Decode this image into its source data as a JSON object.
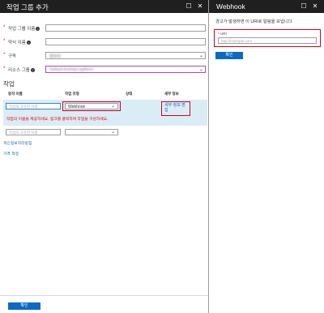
{
  "left_blade": {
    "title": "작업 그룹 추가",
    "form": {
      "group_name_label": "작업 그룹 이름",
      "short_name_label": "약식 이름",
      "subscription_label": "구독",
      "subscription_value": "종량제",
      "resource_group_label": "리소스 그룹",
      "resource_group_value": "Default-ActivityLogAlerts"
    },
    "actions_section": {
      "title": "작업",
      "columns": [
        "동작 이름",
        "작업 유형",
        "상태",
        "세부 정보"
      ],
      "row1": {
        "name_placeholder": "작업의 고유한 이름",
        "type_value": "Webhook",
        "edit_link": "세부 정보 편집",
        "error": "작업의 이름을 제공하세요. 링크를 클릭하여 작업을 구성하세요."
      },
      "row2": {
        "name_placeholder": "작업의 고유한 이름"
      }
    },
    "links": {
      "privacy": "개인정보처리방침",
      "pricing": "가격 책정"
    },
    "ok_button": "확인"
  },
  "right_blade": {
    "title": "Webhook",
    "description": "경고가 발생하면 이 URI로 알림을 보냅니다.",
    "uri_label": "URI",
    "uri_placeholder": "http://example.com",
    "ok_button": "확인"
  },
  "colors": {
    "header_bg": "#1f1f1f",
    "primary_button": "#0b6ac4",
    "highlight_row": "#daecf6",
    "error_red": "#d0021b",
    "link_blue": "#1f6bb5"
  }
}
